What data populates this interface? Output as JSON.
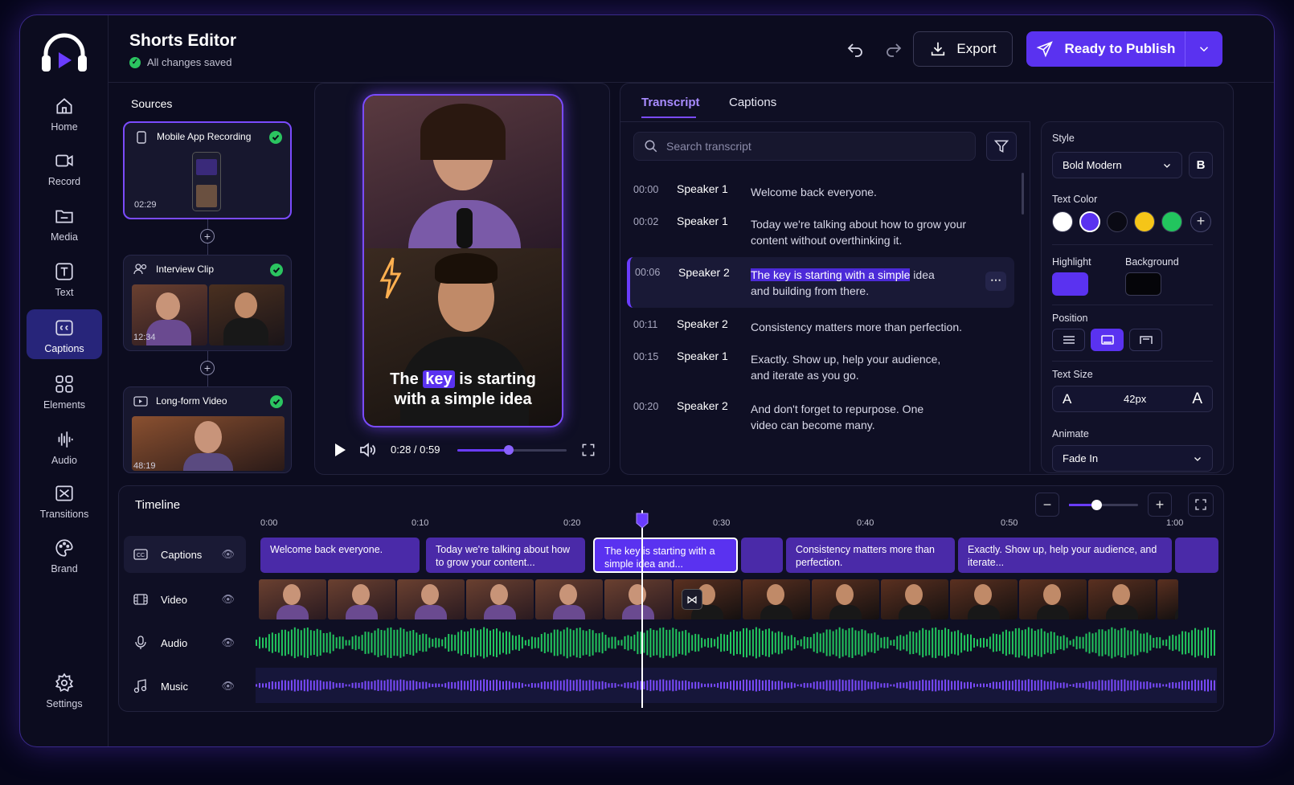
{
  "app": {
    "title": "Shorts Editor",
    "status": "All changes saved"
  },
  "toolbar": {
    "export_label": "Export",
    "publish_label": "Ready to Publish"
  },
  "nav": [
    {
      "label": "Home",
      "icon": "home-icon"
    },
    {
      "label": "Record",
      "icon": "record-icon"
    },
    {
      "label": "Media",
      "icon": "media-icon"
    },
    {
      "label": "Text",
      "icon": "text-icon"
    },
    {
      "label": "Captions",
      "icon": "captions-icon",
      "active": true
    },
    {
      "label": "Elements",
      "icon": "elements-icon"
    },
    {
      "label": "Audio",
      "icon": "audio-icon"
    },
    {
      "label": "Transitions",
      "icon": "transitions-icon"
    },
    {
      "label": "Brand",
      "icon": "brand-icon"
    },
    {
      "label": "Settings",
      "icon": "settings-icon"
    }
  ],
  "sources": {
    "title": "Sources",
    "items": [
      {
        "name": "Mobile App Recording",
        "duration": "02:29"
      },
      {
        "name": "Interview Clip",
        "duration": "12:34"
      },
      {
        "name": "Long-form Video",
        "duration": "48:19"
      }
    ]
  },
  "preview": {
    "caption_before": "The",
    "caption_keyword": "key",
    "caption_after": "is starting",
    "caption_line2": "with a simple idea",
    "time": "0:28 / 0:59",
    "progress": 0.47
  },
  "transcript": {
    "tabs": [
      "Transcript",
      "Captions"
    ],
    "search_placeholder": "Search transcript",
    "rows": [
      {
        "time": "00:00",
        "speaker": "Speaker 1",
        "text": "Welcome back everyone."
      },
      {
        "time": "00:02",
        "speaker": "Speaker 1",
        "text": "Today we're talking about how to grow your content without overthinking it."
      },
      {
        "time": "00:06",
        "speaker": "Speaker 2",
        "highlight": "The key is starting with a simple",
        "text_rest": "idea",
        "text_line2": "and building from there."
      },
      {
        "time": "00:11",
        "speaker": "Speaker 2",
        "text": "Consistency matters more than perfection."
      },
      {
        "time": "00:15",
        "speaker": "Speaker 1",
        "text": "Exactly. Show up, help your audience, and iterate as you go."
      },
      {
        "time": "00:20",
        "speaker": "Speaker 2",
        "text": "And don't forget to repurpose. One video can become many."
      }
    ]
  },
  "style": {
    "style_label": "Style",
    "style_value": "Bold Modern",
    "bold_label": "B",
    "text_color_label": "Text Color",
    "colors": [
      "#ffffff",
      "#5a32f0",
      "#0a0a14",
      "#f5c518",
      "#22c55e"
    ],
    "highlight_label": "Highlight",
    "highlight_color": "#5a32f0",
    "background_label": "Background",
    "background_color": "#050509",
    "position_label": "Position",
    "text_size_label": "Text Size",
    "text_size_small": "A",
    "text_size_value": "42px",
    "text_size_large": "A",
    "animate_label": "Animate",
    "animate_value": "Fade In"
  },
  "timeline": {
    "title": "Timeline",
    "ticks": [
      "0:00",
      "0:10",
      "0:20",
      "0:30",
      "0:40",
      "0:50",
      "1:00"
    ],
    "zoom": 0.4,
    "tracks": [
      "Captions",
      "Video",
      "Audio",
      "Music"
    ],
    "clips": [
      "Welcome back everyone.",
      "Today we're talking about how to grow your content...",
      "The key is starting with a simple idea and...",
      "Consistency matters more than perfection.",
      "Exactly. Show up, help your audience, and iterate..."
    ]
  }
}
